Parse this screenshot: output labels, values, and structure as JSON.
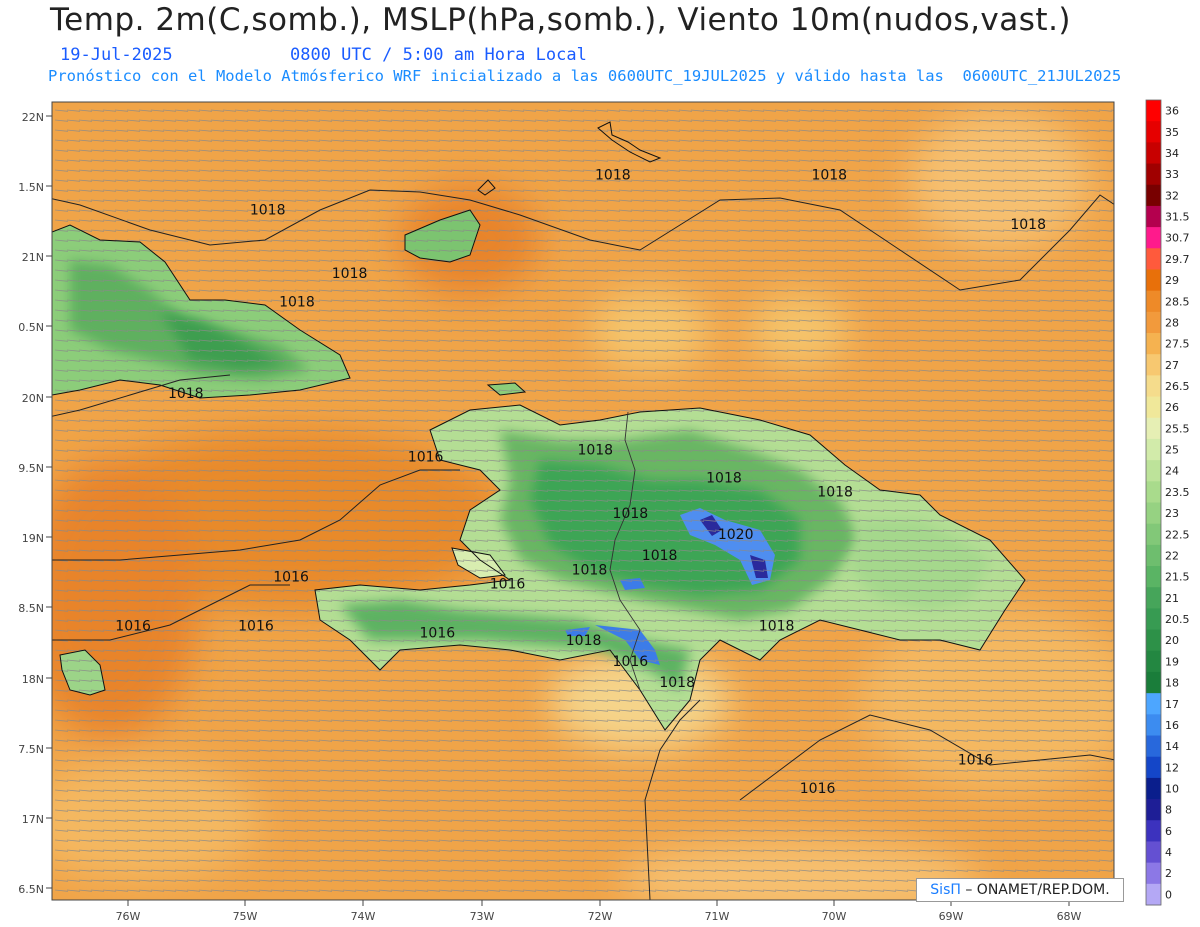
{
  "header": {
    "title": "Temp. 2m(C,somb.), MSLP(hPa,somb.), Viento 10m(nudos,vast.)",
    "date": "19-Jul-2025",
    "time": "0800 UTC / 5:00 am Hora Local",
    "info": "Pronóstico con el Modelo Atmósferico WRF inicializado a las 0600UTC_19JUL2025 y válido hasta las  0600UTC_21JUL2025"
  },
  "axes": {
    "lat_labels": [
      "22N",
      "1.5N",
      "21N",
      "0.5N",
      "20N",
      "9.5N",
      "19N",
      "8.5N",
      "18N",
      "7.5N",
      "17N",
      "6.5N"
    ],
    "lon_labels": [
      "76W",
      "75W",
      "74W",
      "73W",
      "72W",
      "71W",
      "70W",
      "69W",
      "68W"
    ]
  },
  "colorbar": {
    "labels": [
      "36",
      "35",
      "34",
      "33",
      "32",
      "31.5",
      "30.7",
      "29.7",
      "29",
      "28.5",
      "28",
      "27.5",
      "27",
      "26.5",
      "26",
      "25.5",
      "25",
      "24",
      "23.5",
      "23",
      "22.5",
      "22",
      "21.5",
      "21",
      "20.5",
      "20",
      "19",
      "18",
      "17",
      "16",
      "14",
      "12",
      "10",
      "8",
      "6",
      "4",
      "2",
      "0"
    ],
    "colors": [
      "#ff0000",
      "#e60000",
      "#c80000",
      "#a00000",
      "#780000",
      "#b4004e",
      "#ff1a8c",
      "#ff5a3c",
      "#e8700a",
      "#ee8a28",
      "#f29a3c",
      "#f5b250",
      "#f7c870",
      "#f5dc8c",
      "#f0e89a",
      "#e6efb4",
      "#d2ebaa",
      "#bde39a",
      "#a9db8c",
      "#96d282",
      "#82c878",
      "#6ebe6e",
      "#5ab464",
      "#46a55a",
      "#379b52",
      "#2d9148",
      "#238741",
      "#1a7d3a",
      "#4da6ff",
      "#3c8cf0",
      "#2868dc",
      "#1446c8",
      "#0a1e8c",
      "#1e1e96",
      "#3c32be",
      "#6450d2",
      "#8c78e6",
      "#b4a8f5"
    ]
  },
  "pressure_labels": [
    {
      "text": "1018",
      "lon": -72.0,
      "lat": 21.55
    },
    {
      "text": "1018",
      "lon": -74.95,
      "lat": 21.3
    },
    {
      "text": "1018",
      "lon": -70.15,
      "lat": 21.55
    },
    {
      "text": "1018",
      "lon": -68.45,
      "lat": 21.2
    },
    {
      "text": "1018",
      "lon": -74.25,
      "lat": 20.85
    },
    {
      "text": "1018",
      "lon": -74.7,
      "lat": 20.65
    },
    {
      "text": "1018",
      "lon": -75.65,
      "lat": 20.0
    },
    {
      "text": "1016",
      "lon": -73.6,
      "lat": 19.55
    },
    {
      "text": "1018",
      "lon": -72.15,
      "lat": 19.6
    },
    {
      "text": "1018",
      "lon": -71.05,
      "lat": 19.4
    },
    {
      "text": "1018",
      "lon": -70.1,
      "lat": 19.3
    },
    {
      "text": "1018",
      "lon": -71.85,
      "lat": 19.15
    },
    {
      "text": "1020",
      "lon": -70.95,
      "lat": 19.0
    },
    {
      "text": "1018",
      "lon": -71.6,
      "lat": 18.85
    },
    {
      "text": "1018",
      "lon": -72.2,
      "lat": 18.75
    },
    {
      "text": "1016",
      "lon": -74.75,
      "lat": 18.7
    },
    {
      "text": "1016",
      "lon": -72.9,
      "lat": 18.65
    },
    {
      "text": "1016",
      "lon": -76.1,
      "lat": 18.35
    },
    {
      "text": "1016",
      "lon": -75.05,
      "lat": 18.35
    },
    {
      "text": "1016",
      "lon": -73.5,
      "lat": 18.3
    },
    {
      "text": "1018",
      "lon": -72.25,
      "lat": 18.25
    },
    {
      "text": "1018",
      "lon": -70.6,
      "lat": 18.35
    },
    {
      "text": "1016",
      "lon": -71.85,
      "lat": 18.1
    },
    {
      "text": "1018",
      "lon": -71.45,
      "lat": 17.95
    },
    {
      "text": "1016",
      "lon": -68.9,
      "lat": 17.4
    },
    {
      "text": "1016",
      "lon": -70.25,
      "lat": 17.2
    }
  ],
  "credit": {
    "brand": "SisΠ",
    "rest": "– ONAMET/REP.DOM."
  }
}
